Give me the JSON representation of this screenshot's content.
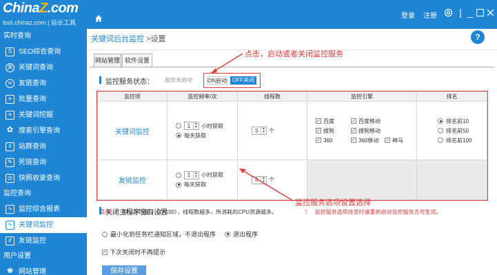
{
  "header": {
    "logo": "China",
    "logo_mark": "Z",
    "logo_suffix": ".com",
    "subtitle": "tool.chinaz.com | 站长工具",
    "login": "登录",
    "register": "注册"
  },
  "sidebar": {
    "groups": [
      {
        "label": "实时查询",
        "items": [
          {
            "label": "SEO综合查询",
            "icon": "seo-icon"
          },
          {
            "label": "关键词查询",
            "icon": "keyword-icon"
          },
          {
            "label": "友链查询",
            "icon": "link-icon"
          },
          {
            "label": "批量查询",
            "icon": "batch-icon"
          },
          {
            "label": "关键词挖掘",
            "icon": "mining-icon"
          },
          {
            "label": "搜索引擎查询",
            "icon": "search-engine-icon"
          },
          {
            "label": "站群查询",
            "icon": "site-group-icon"
          },
          {
            "label": "死链查询",
            "icon": "dead-link-icon"
          },
          {
            "label": "快照收录查询",
            "icon": "snapshot-icon"
          }
        ]
      },
      {
        "label": "监控查询",
        "items": [
          {
            "label": "监控综合报表",
            "icon": "report-icon"
          },
          {
            "label": "关键词监控",
            "icon": "monitor-icon",
            "active": true
          },
          {
            "label": "友链监控",
            "icon": "link-monitor-icon"
          }
        ]
      },
      {
        "label": "用户设置",
        "items": [
          {
            "label": "网站管理",
            "icon": "user-icon"
          }
        ]
      }
    ]
  },
  "breadcrumb": {
    "parent": "关键词后台监控",
    "separator": ">",
    "current": "设置"
  },
  "tabs": [
    {
      "label": "网站管理"
    },
    {
      "label": "软件设置",
      "active": true
    }
  ],
  "monitor_service": {
    "title": "监控服务状态：",
    "status": "服务未启动",
    "on_label": "ON启动",
    "off_label": "OFF关闭"
  },
  "table": {
    "headers": [
      "监控项",
      "监控频率/次",
      "线程数",
      "监控引擎",
      "排名"
    ],
    "rows": [
      {
        "name": "关键词监控",
        "freq_value": "1",
        "freq_unit": "小时获取",
        "daily": "每天获取",
        "threads": "3",
        "threads_unit": "个",
        "engines": [
          "百度",
          "百度移动",
          "搜狗",
          "搜狗移动",
          "360",
          "360移动",
          "神马"
        ],
        "ranks": [
          "排名前10",
          "排名前50",
          "排名前100"
        ]
      },
      {
        "name": "友链监控",
        "freq_value": "1",
        "freq_unit": "小时获取",
        "daily": "每天获取",
        "threads": "3",
        "threads_unit": "个"
      }
    ]
  },
  "hint": {
    "prefix": "提示：！",
    "text": "默认3个线程（1~100），线程数越多，所消耗的CPU资源越多。",
    "warn_mark": "！",
    "warn": "监控服务选项改变时请重新启动监控服务方可生效。"
  },
  "close_section": {
    "title": "关闭主程序窗口设置",
    "minimize": "最小化到任务栏通知区域，不退出程序",
    "exit": "退出程序",
    "no_prompt": "下次关闭时不再提示"
  },
  "save_button": "保存设置",
  "annotations": {
    "top": "点击，启动或者关闭监控服务",
    "bottom": "监控服务选项设置选择"
  }
}
